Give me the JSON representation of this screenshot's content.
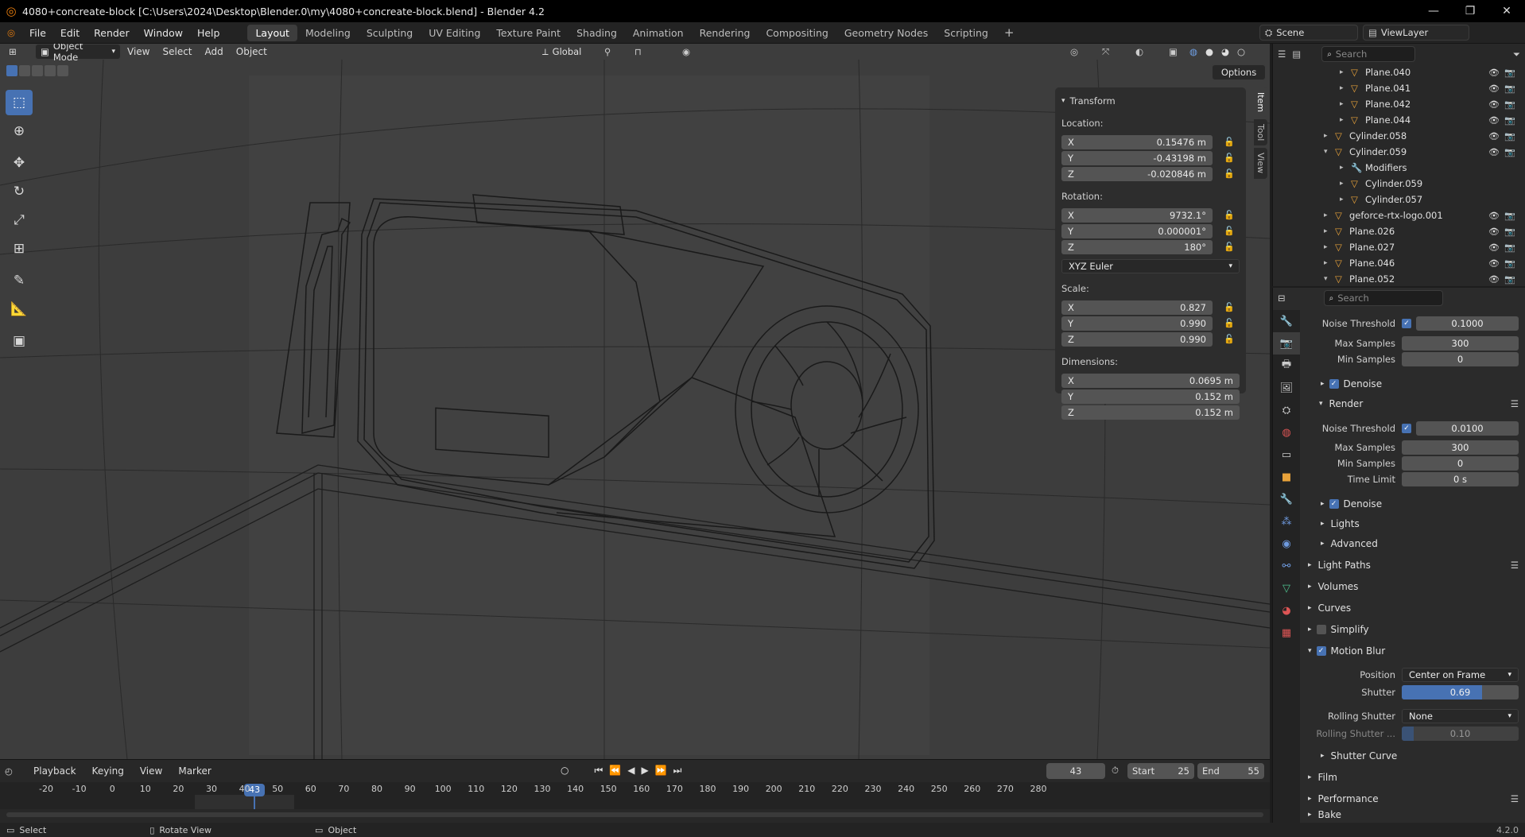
{
  "window": {
    "title": "4080+concreate-block [C:\\Users\\2024\\Desktop\\Blender.0\\my\\4080+concreate-block.blend] - Blender 4.2"
  },
  "menu": [
    "File",
    "Edit",
    "Render",
    "Window",
    "Help"
  ],
  "workspaces": [
    "Layout",
    "Modeling",
    "Sculpting",
    "UV Editing",
    "Texture Paint",
    "Shading",
    "Animation",
    "Rendering",
    "Compositing",
    "Geometry Nodes",
    "Scripting"
  ],
  "active_workspace": "Layout",
  "scene": {
    "name": "Scene",
    "view_layer": "ViewLayer"
  },
  "viewport": {
    "mode": "Object Mode",
    "menus": [
      "View",
      "Select",
      "Add",
      "Object"
    ],
    "orientation": "Global",
    "options_label": "Options"
  },
  "npanel": {
    "tabs": [
      "Item",
      "Tool",
      "View"
    ],
    "transform_label": "Transform",
    "location_label": "Location:",
    "rotation_label": "Rotation:",
    "scale_label": "Scale:",
    "dimensions_label": "Dimensions:",
    "location": {
      "x": "0.15476 m",
      "y": "-0.43198 m",
      "z": "-0.020846 m"
    },
    "rotation": {
      "x": "9732.1°",
      "y": "0.000001°",
      "z": "180°"
    },
    "rotation_mode": "XYZ Euler",
    "scale": {
      "x": "0.827",
      "y": "0.990",
      "z": "0.990"
    },
    "dimensions": {
      "x": "0.0695 m",
      "y": "0.152 m",
      "z": "0.152 m"
    },
    "axis": [
      "X",
      "Y",
      "Z"
    ]
  },
  "outliner": {
    "search_placeholder": "Search",
    "items": [
      {
        "name": "Plane.040",
        "indent": 2,
        "expanded": false
      },
      {
        "name": "Plane.041",
        "indent": 2,
        "expanded": false
      },
      {
        "name": "Plane.042",
        "indent": 2,
        "expanded": false
      },
      {
        "name": "Plane.044",
        "indent": 2,
        "expanded": false
      },
      {
        "name": "Cylinder.058",
        "indent": 1,
        "expanded": false
      },
      {
        "name": "Cylinder.059",
        "indent": 1,
        "expanded": true
      },
      {
        "name": "Modifiers",
        "indent": 2,
        "expanded": false
      },
      {
        "name": "Cylinder.059",
        "indent": 2,
        "expanded": false
      },
      {
        "name": "Cylinder.057",
        "indent": 2,
        "expanded": false
      },
      {
        "name": "geforce-rtx-logo.001",
        "indent": 1,
        "expanded": false
      },
      {
        "name": "Plane.026",
        "indent": 1,
        "expanded": false
      },
      {
        "name": "Plane.027",
        "indent": 1,
        "expanded": false
      },
      {
        "name": "Plane.046",
        "indent": 1,
        "expanded": false
      },
      {
        "name": "Plane.052",
        "indent": 1,
        "expanded": true
      }
    ]
  },
  "properties": {
    "search_placeholder": "Search",
    "noise_threshold_label": "Noise Threshold",
    "max_samples_label": "Max Samples",
    "min_samples_label": "Min Samples",
    "time_limit_label": "Time Limit",
    "viewport_noise_threshold": "0.1000",
    "viewport_max_samples": "300",
    "viewport_min_samples": "0",
    "denoise_label": "Denoise",
    "render_label": "Render",
    "render_noise_threshold": "0.0100",
    "render_max_samples": "300",
    "render_min_samples": "0",
    "render_time_limit": "0 s",
    "panels": [
      "Lights",
      "Advanced",
      "Light Paths",
      "Volumes",
      "Curves",
      "Simplify",
      "Motion Blur",
      "Shutter Curve",
      "Film",
      "Performance",
      "Bake"
    ],
    "position_label": "Position",
    "position_value": "Center on Frame",
    "shutter_label": "Shutter",
    "shutter_value": "0.69",
    "shutter_fraction": 0.69,
    "rolling_shutter_label": "Rolling Shutter",
    "rolling_shutter_value": "None",
    "rolling_shutter_dur_label": "Rolling Shutter ...",
    "rolling_shutter_dur_value": "0.10",
    "rolling_shutter_fraction": 0.1
  },
  "timeline": {
    "menus": [
      "Playback",
      "Keying",
      "View",
      "Marker"
    ],
    "current_frame": "43",
    "start_label": "Start",
    "start": "25",
    "end_label": "End",
    "end": "55",
    "ruler": [
      "-20",
      "-10",
      "0",
      "10",
      "20",
      "30",
      "40",
      "50",
      "60",
      "70",
      "80",
      "90",
      "100",
      "110",
      "120",
      "130",
      "140",
      "150",
      "160",
      "170",
      "180",
      "190",
      "200",
      "210",
      "220",
      "230",
      "240",
      "250",
      "260",
      "270",
      "280"
    ]
  },
  "statusbar": {
    "select": "Select",
    "rotate": "Rotate View",
    "object": "Object",
    "version": "4.2.0"
  },
  "colors": {
    "accent": "#4772b3",
    "bg": "#3d3d3d",
    "panel": "#2b2b2b",
    "object_orange": "#e8a23a",
    "modifier_blue": "#6f9be0",
    "mesh_green": "#4fc28f"
  }
}
